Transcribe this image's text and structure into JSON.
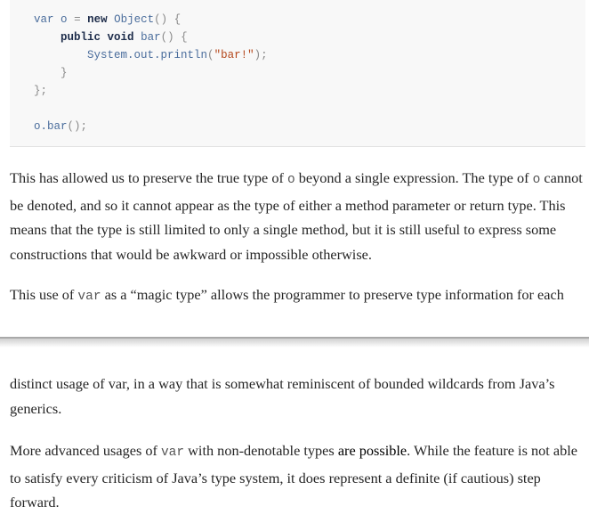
{
  "code": {
    "l1_var": "var",
    "l1_o": "o",
    "l1_eq": "=",
    "l1_new": "new",
    "l1_obj": "Object",
    "l1_paren": "()",
    "l1_brace": "{",
    "l2_public": "public",
    "l2_void": "void",
    "l2_bar": "bar",
    "l2_paren": "()",
    "l2_brace": "{",
    "l3_sys": "System.out.println",
    "l3_open": "(",
    "l3_str": "\"bar!\"",
    "l3_close": ");",
    "l4_brace": "}",
    "l5_end": "};",
    "l6_call": "o.bar",
    "l6_tail": "();"
  },
  "paragraphs": {
    "p1_a": "This has allowed us to preserve the true type of ",
    "p1_code": "o",
    "p1_b": " beyond a single expression. The type of ",
    "p1_code2": "o",
    "p1_c": " cannot be denoted, and so it cannot appear as the type of either a method parameter or return type. This means that the type is still limited to only a single method, but it is still useful to express some constructions that would be awkward or impossible otherwise.",
    "p2_a": "This use of ",
    "p2_code": "var",
    "p2_b": " as a “magic type” allows the programmer to preserve type information for each",
    "p3": "distinct usage of var, in a way that is somewhat reminiscent of bounded wildcards from Java’s generics.",
    "p4_a": "More advanced usages of ",
    "p4_code": "var",
    "p4_b": " with non-denotable types ",
    "p4_hl": "are possible",
    "p4_c": ". While the feature is not able to satisfy every criticism of Java’s type system, it does represent a definite (if cautious) step forward."
  }
}
